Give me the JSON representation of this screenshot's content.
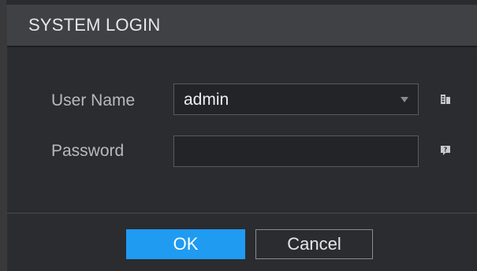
{
  "dialog": {
    "title": "SYSTEM LOGIN"
  },
  "form": {
    "username_label": "User Name",
    "username_value": "admin",
    "password_label": "Password",
    "password_value": ""
  },
  "buttons": {
    "ok_label": "OK",
    "cancel_label": "Cancel"
  },
  "icons": {
    "username_side": "keyboard-icon",
    "password_side": "help-icon"
  },
  "colors": {
    "accent": "#1f9bf2",
    "title_bar": "#404145",
    "dialog_bg": "#2b2c30"
  }
}
